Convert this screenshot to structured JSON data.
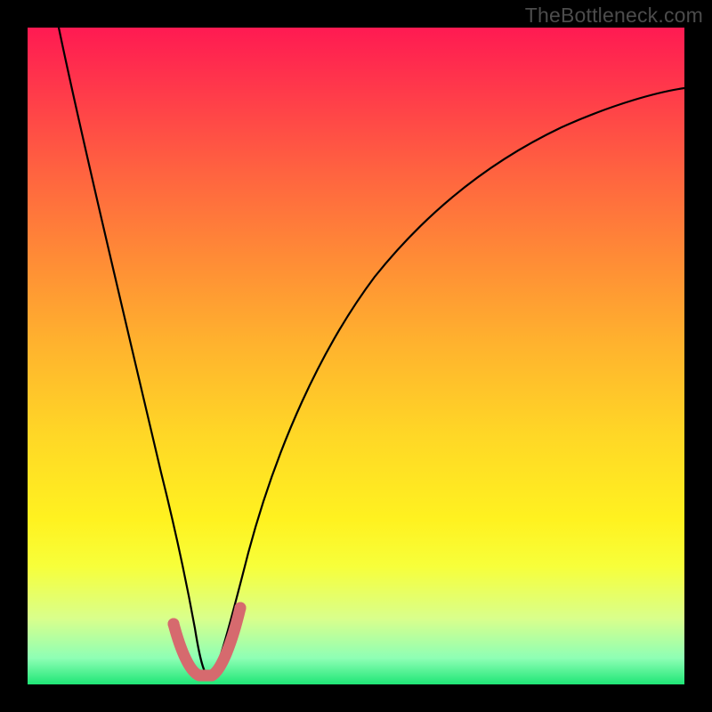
{
  "watermark": "TheBottleneck.com",
  "chart_data": {
    "type": "line",
    "title": "",
    "xlabel": "",
    "ylabel": "",
    "xlim": [
      0,
      1
    ],
    "ylim": [
      0,
      1
    ],
    "series": [
      {
        "name": "main-curve",
        "x": [
          0.048,
          0.08,
          0.12,
          0.16,
          0.2,
          0.22,
          0.24,
          0.255,
          0.27,
          0.29,
          0.31,
          0.33,
          0.36,
          0.4,
          0.45,
          0.5,
          0.55,
          0.6,
          0.66,
          0.73,
          0.8,
          0.88,
          0.96,
          1.0
        ],
        "y": [
          1.0,
          0.82,
          0.62,
          0.43,
          0.22,
          0.12,
          0.04,
          0.01,
          0.01,
          0.04,
          0.12,
          0.22,
          0.34,
          0.46,
          0.56,
          0.63,
          0.69,
          0.74,
          0.78,
          0.82,
          0.85,
          0.87,
          0.885,
          0.89
        ]
      },
      {
        "name": "highlight-segment",
        "x": [
          0.222,
          0.235,
          0.248,
          0.262,
          0.275,
          0.288,
          0.3
        ],
        "y": [
          0.075,
          0.035,
          0.012,
          0.01,
          0.02,
          0.055,
          0.105
        ]
      }
    ],
    "background_gradient_stops": [
      {
        "pos": 0.0,
        "color": "#ff1a52"
      },
      {
        "pos": 0.5,
        "color": "#ffcc28"
      },
      {
        "pos": 0.82,
        "color": "#f7ff3a"
      },
      {
        "pos": 1.0,
        "color": "#1fe676"
      }
    ]
  }
}
